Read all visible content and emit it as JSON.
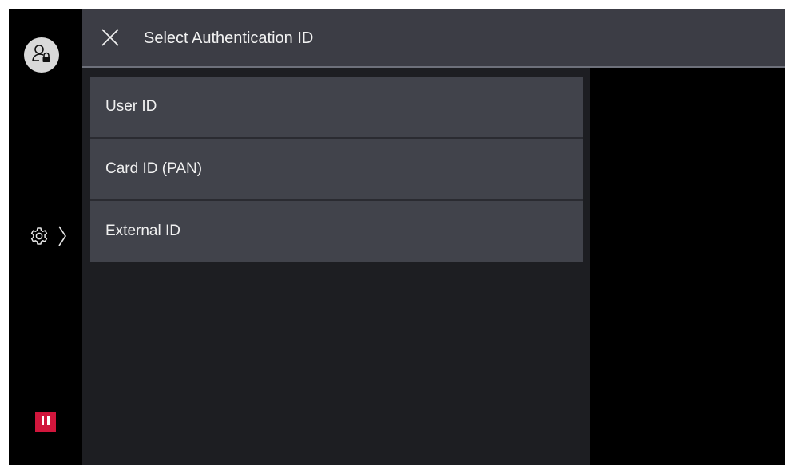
{
  "header": {
    "title": "Select Authentication ID",
    "close_icon": "close-icon"
  },
  "rail": {
    "user_icon": "user-lock-icon",
    "settings_icon": "gear-icon",
    "chevron_icon": "chevron-right-icon",
    "pause_icon": "pause-icon",
    "pause_color": "#d1163c"
  },
  "auth_options": [
    {
      "label": "User ID"
    },
    {
      "label": "Card ID (PAN)"
    },
    {
      "label": "External ID"
    }
  ],
  "colors": {
    "header_bg": "#3c3d45",
    "item_bg": "#41434b",
    "list_bg": "#1d1e22",
    "accent_line": "#6e717b"
  }
}
